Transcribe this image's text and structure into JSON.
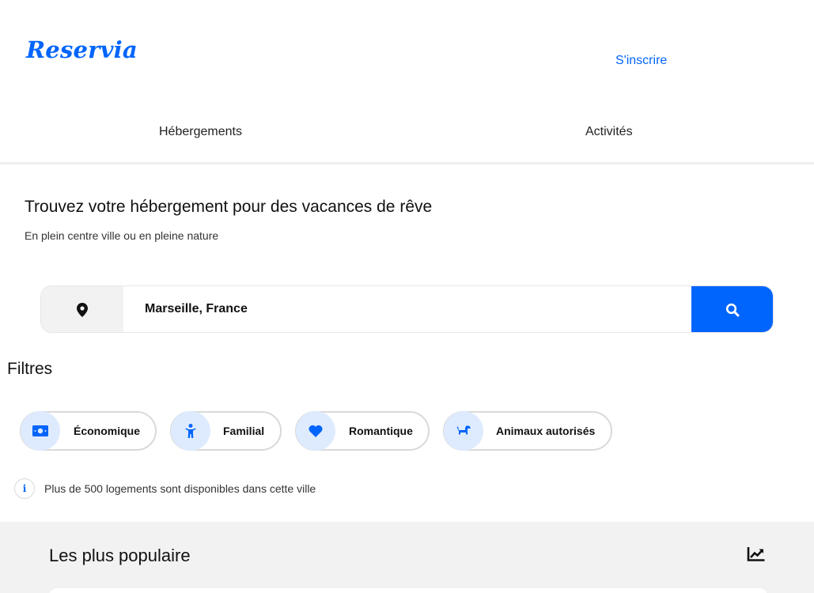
{
  "header": {
    "logo": "Reservia",
    "signup": "S'inscrire"
  },
  "nav": {
    "tabs": [
      {
        "label": "Hébergements"
      },
      {
        "label": "Activités"
      }
    ]
  },
  "hero": {
    "title": "Trouvez votre hébergement pour des vacances de rêve",
    "subtitle": "En plein centre ville ou en pleine nature"
  },
  "search": {
    "value": "Marseille, France",
    "pin_icon": "map-pin-icon",
    "button_icon": "search-icon"
  },
  "filters": {
    "title": "Filtres",
    "items": [
      {
        "label": "Économique",
        "icon": "money-icon"
      },
      {
        "label": "Familial",
        "icon": "child-icon"
      },
      {
        "label": "Romantique",
        "icon": "heart-icon"
      },
      {
        "label": "Animaux autorisés",
        "icon": "dog-icon"
      }
    ]
  },
  "info": {
    "text": "Plus de 500 logements sont disponibles dans cette ville"
  },
  "popular": {
    "title": "Les plus populaire",
    "icon": "trend-up-icon"
  },
  "colors": {
    "accent": "#0065fc",
    "chip_bg": "#deebff",
    "section_bg": "#f2f2f2"
  }
}
